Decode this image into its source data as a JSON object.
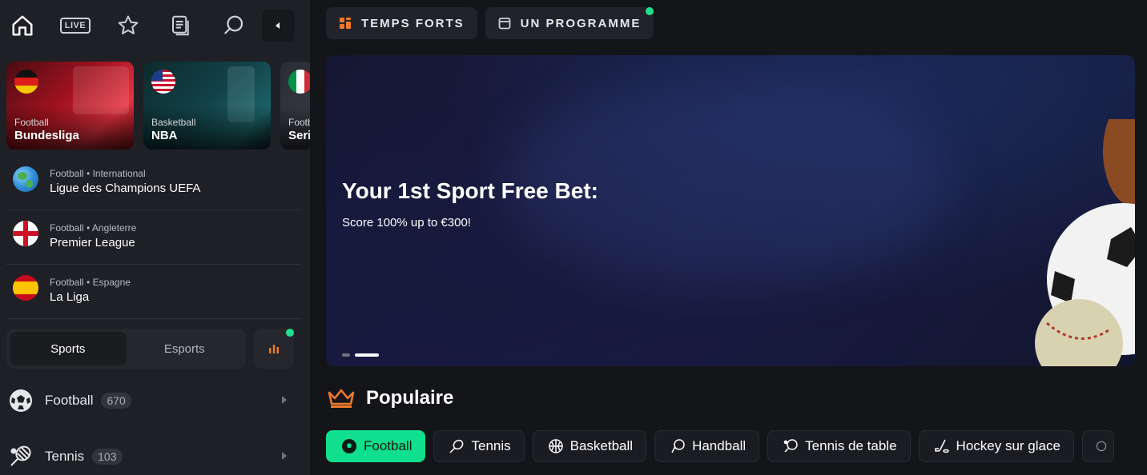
{
  "sidebar": {
    "nav": {
      "live_label": "LIVE"
    },
    "featured": [
      {
        "sport": "Football",
        "league": "Bundesliga"
      },
      {
        "sport": "Basketball",
        "league": "NBA"
      },
      {
        "sport": "Footb",
        "league": "Serie"
      }
    ],
    "leagues": [
      {
        "sport": "Football",
        "region": "International",
        "name": "Ligue des Champions UEFA"
      },
      {
        "sport": "Football",
        "region": "Angleterre",
        "name": "Premier League"
      },
      {
        "sport": "Football",
        "region": "Espagne",
        "name": "La Liga"
      }
    ],
    "toggle": {
      "sports": "Sports",
      "esports": "Esports"
    },
    "sports": [
      {
        "label": "Football",
        "count": "670"
      },
      {
        "label": "Tennis",
        "count": "103"
      }
    ]
  },
  "main": {
    "tabs": [
      {
        "label": "TEMPS FORTS"
      },
      {
        "label": "UN PROGRAMME"
      }
    ],
    "banner": {
      "title": "Your 1st Sport Free Bet:",
      "subtitle": "Score 100% up to €300!",
      "slide_count": 2,
      "active_slide": 2
    },
    "popular": {
      "title": "Populaire",
      "chips": [
        {
          "label": "Football",
          "active": true
        },
        {
          "label": "Tennis"
        },
        {
          "label": "Basketball"
        },
        {
          "label": "Handball"
        },
        {
          "label": "Tennis de table"
        },
        {
          "label": "Hockey sur glace"
        }
      ]
    }
  },
  "colors": {
    "accent": "#10e08e",
    "sidebar_bg": "#1f2025",
    "page_bg": "#141518",
    "orange": "#f07a2a"
  }
}
